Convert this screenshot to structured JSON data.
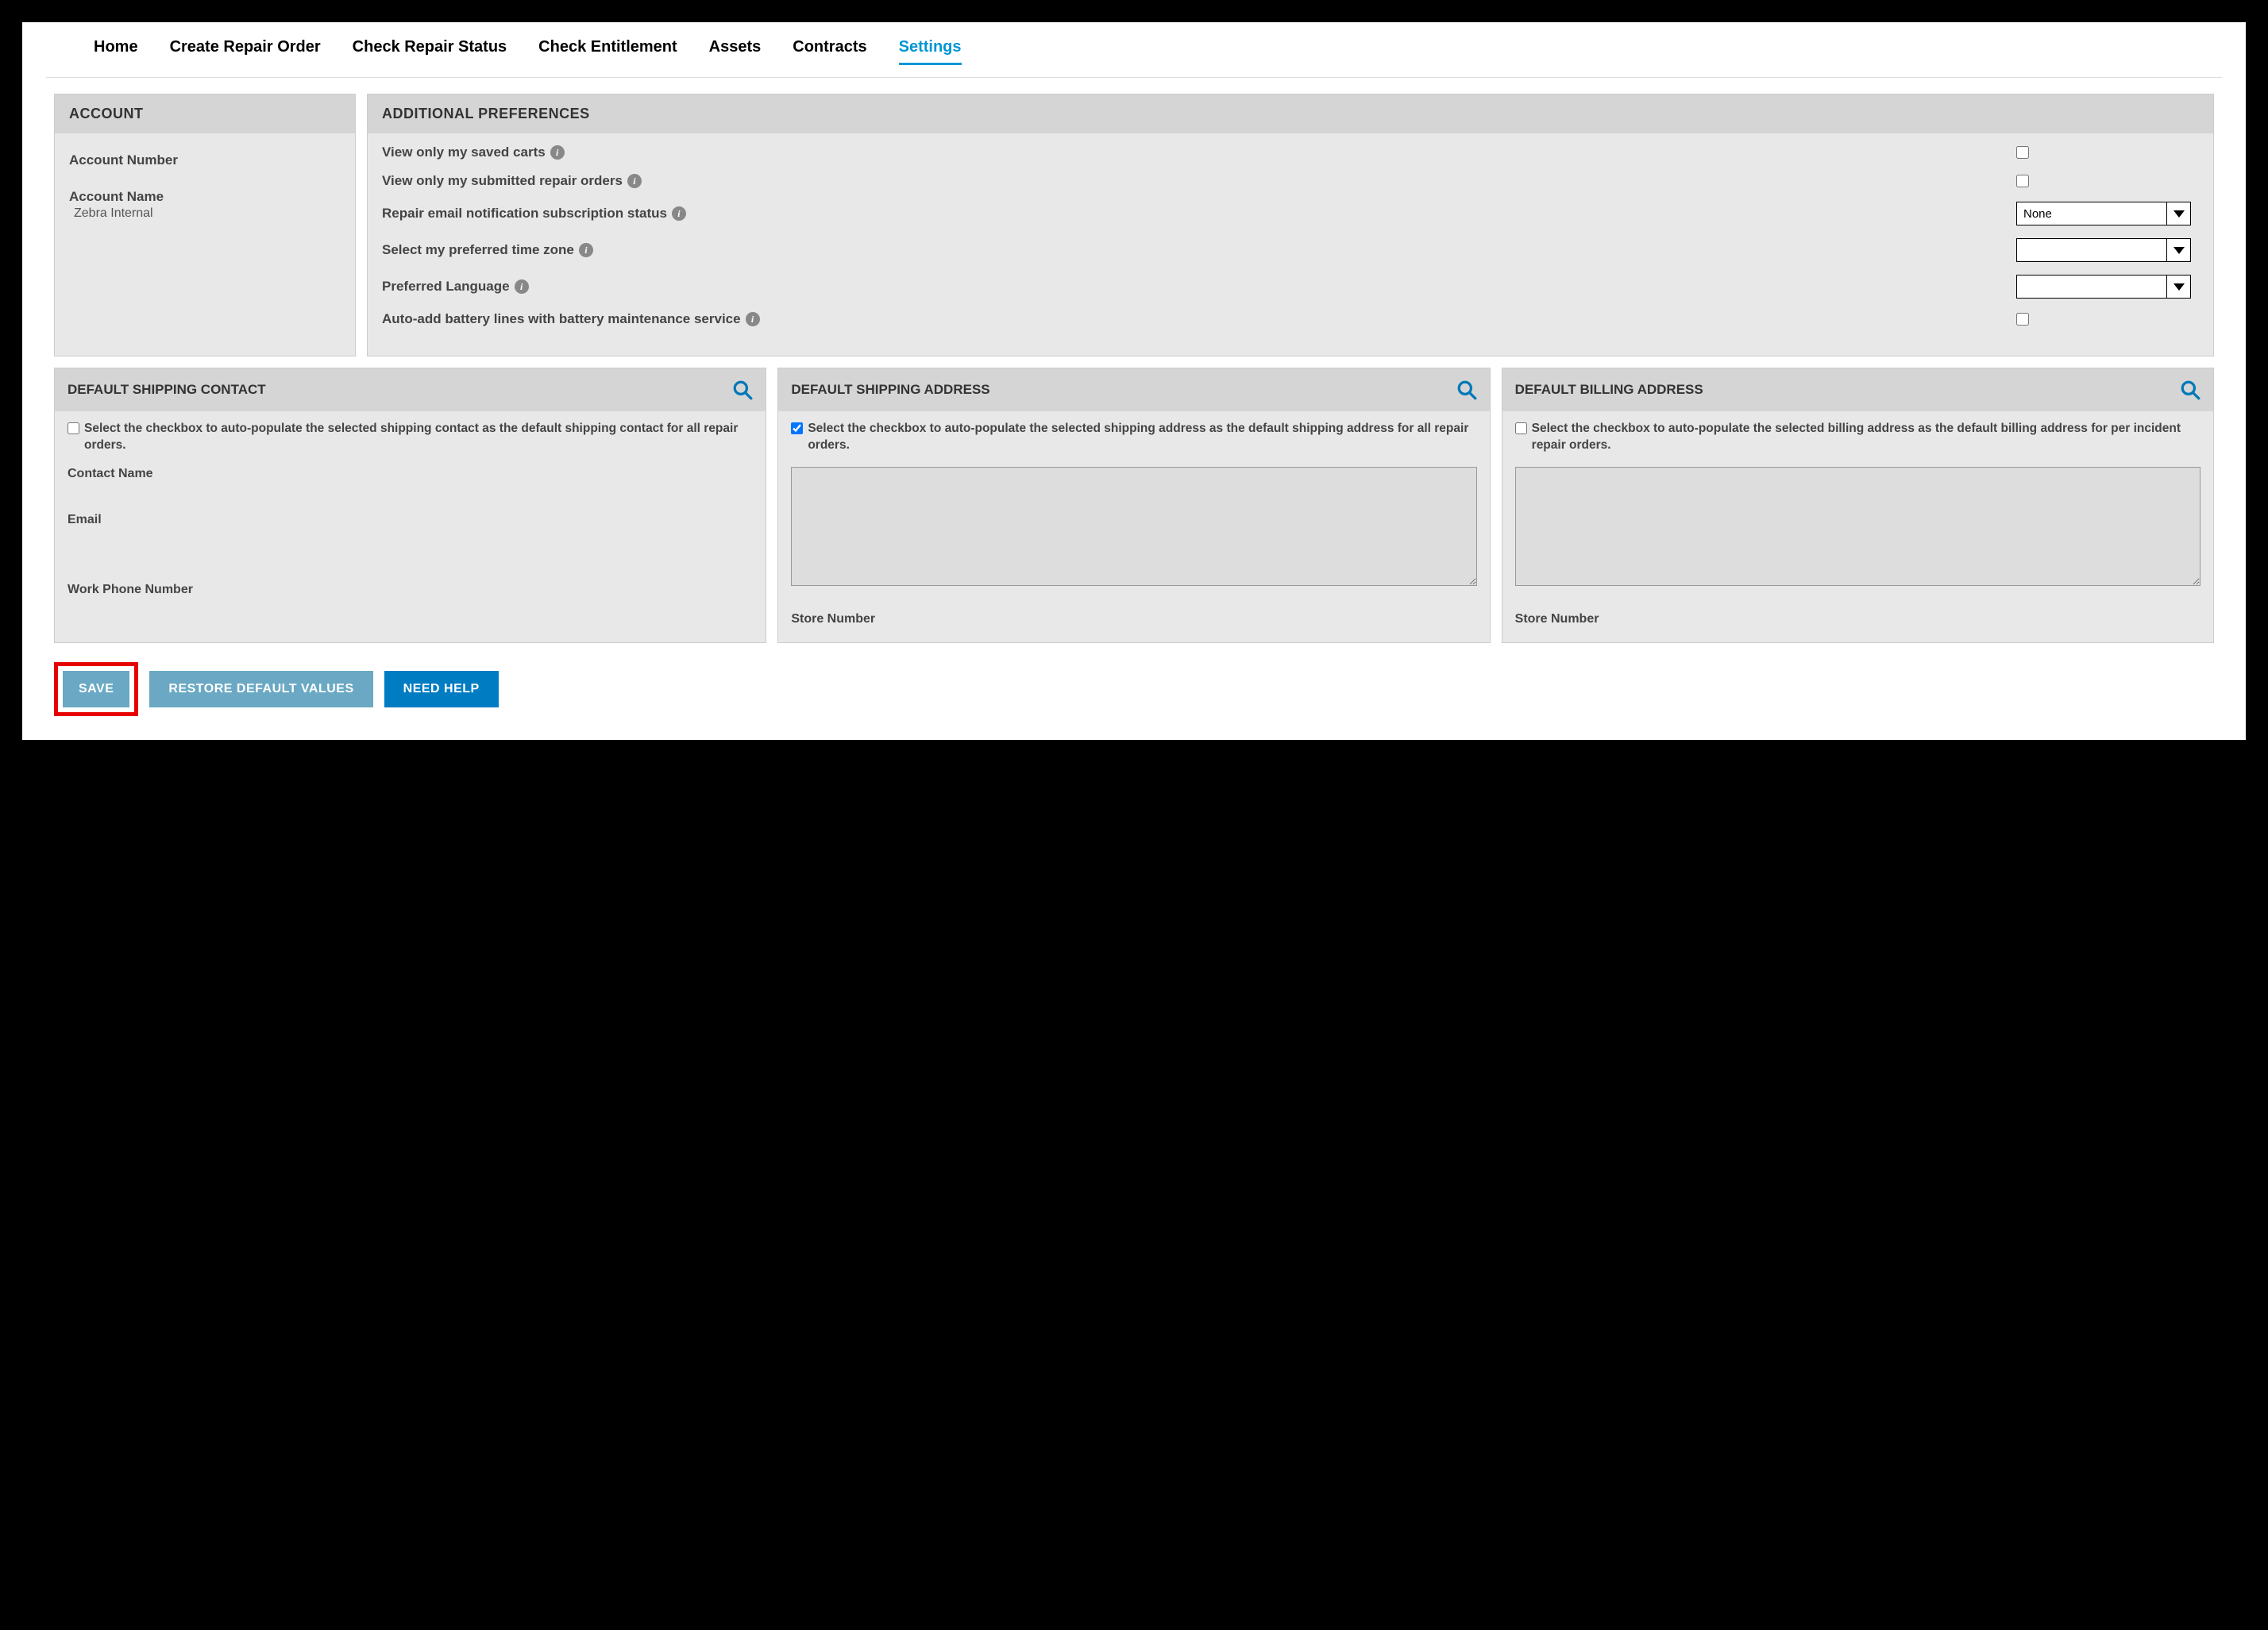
{
  "nav": {
    "items": [
      "Home",
      "Create Repair Order",
      "Check Repair Status",
      "Check Entitlement",
      "Assets",
      "Contracts",
      "Settings"
    ],
    "activeIndex": 6
  },
  "account": {
    "header": "ACCOUNT",
    "numberLabel": "Account Number",
    "numberValue": "",
    "nameLabel": "Account Name",
    "nameValue": "Zebra Internal"
  },
  "prefs": {
    "header": "ADDITIONAL PREFERENCES",
    "savedCartsLabel": "View only my saved carts",
    "savedCartsChecked": false,
    "submittedOrdersLabel": "View only my submitted repair orders",
    "submittedOrdersChecked": false,
    "emailSubLabel": "Repair email notification subscription status",
    "emailSubValue": "None",
    "timezoneLabel": "Select my preferred time zone",
    "timezoneValue": "",
    "languageLabel": "Preferred Language",
    "languageValue": "",
    "autoBatteryLabel": "Auto-add battery lines with battery maintenance service",
    "autoBatteryChecked": false
  },
  "shippingContact": {
    "header": "DEFAULT SHIPPING CONTACT",
    "autoText": "Select the checkbox to auto-populate the selected shipping contact as the default shipping contact for all repair orders.",
    "autoChecked": false,
    "contactNameLabel": "Contact Name",
    "emailLabel": "Email",
    "workPhoneLabel": "Work Phone Number"
  },
  "shippingAddress": {
    "header": "DEFAULT SHIPPING ADDRESS",
    "autoText": "Select the checkbox to auto-populate the selected shipping address as the default shipping address for all repair orders.",
    "autoChecked": true,
    "storeLabel": "Store Number"
  },
  "billingAddress": {
    "header": "DEFAULT BILLING ADDRESS",
    "autoText": "Select the checkbox to auto-populate the selected billing address as the default billing address for per incident repair orders.",
    "autoChecked": false,
    "storeLabel": "Store Number"
  },
  "buttons": {
    "save": "SAVE",
    "restore": "RESTORE DEFAULT VALUES",
    "needHelp": "NEED HELP"
  }
}
